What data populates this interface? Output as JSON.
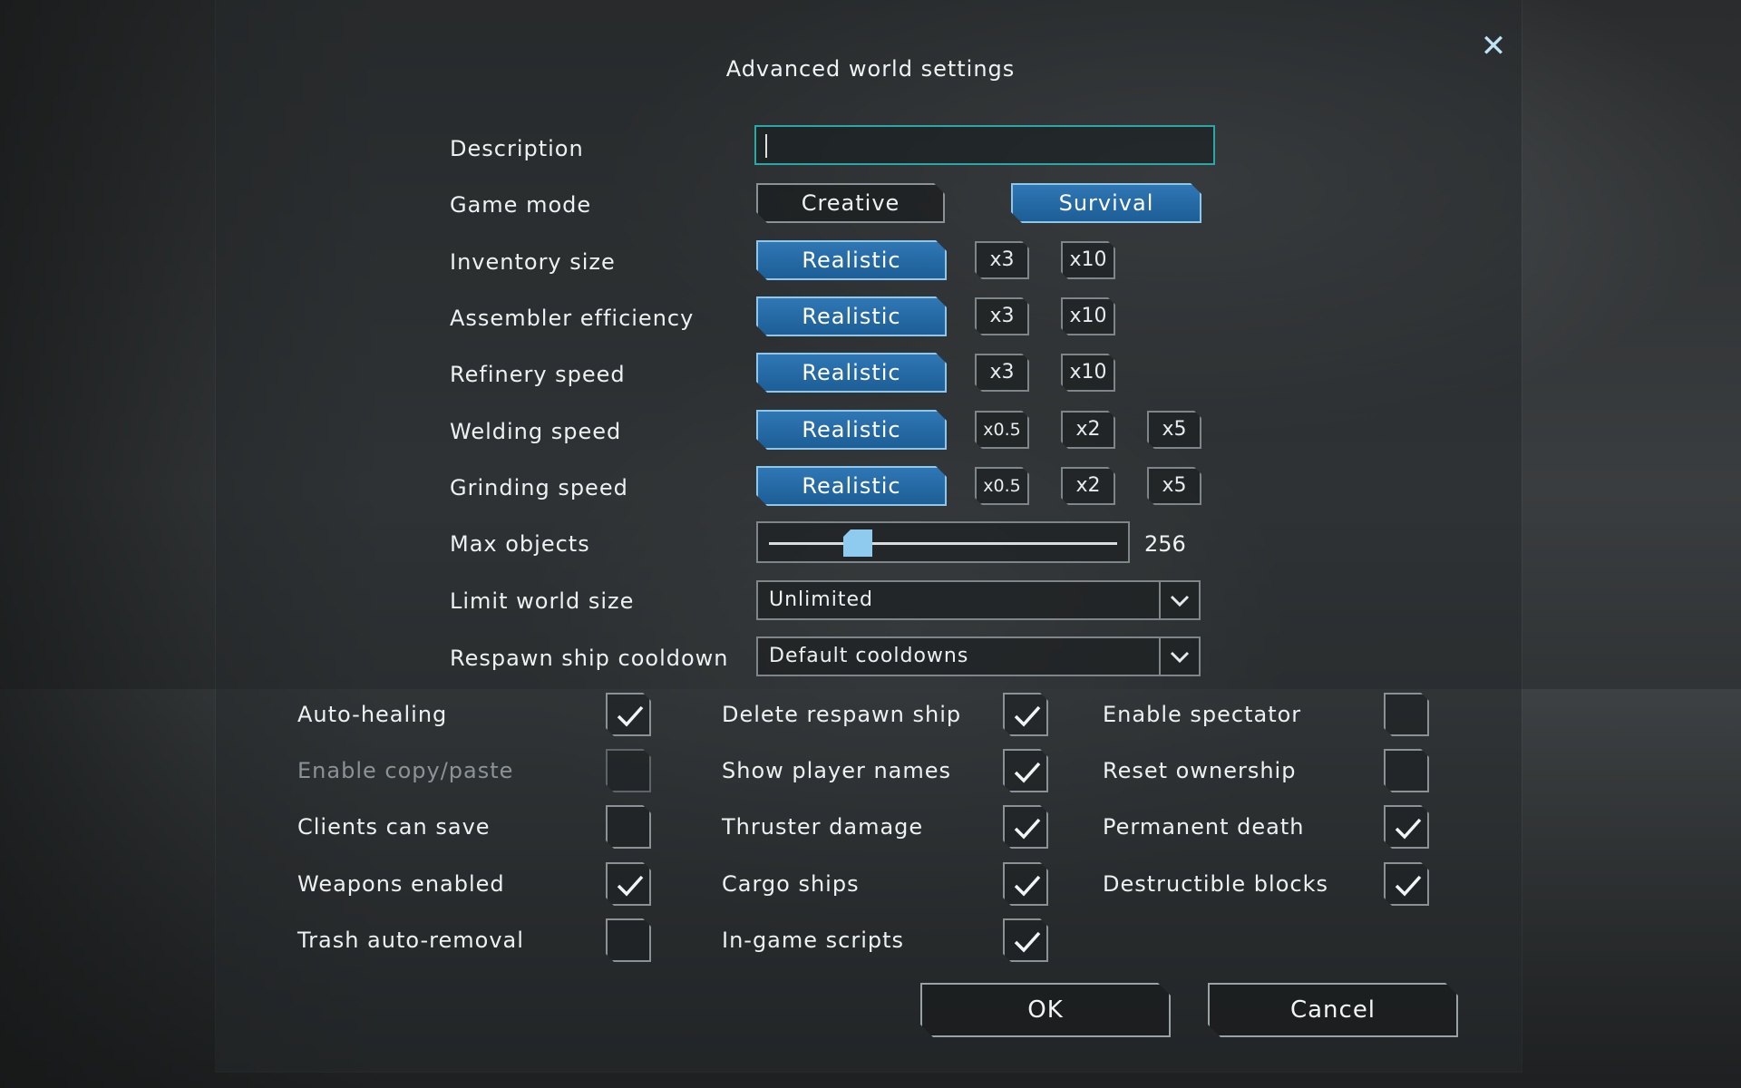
{
  "dialog": {
    "title": "Advanced world settings",
    "close_icon": "close-icon"
  },
  "description": {
    "label": "Description",
    "value": ""
  },
  "game_mode": {
    "label": "Game mode",
    "options": [
      "Creative",
      "Survival"
    ],
    "selected": "Survival"
  },
  "inventory_size": {
    "label": "Inventory size",
    "options": [
      "Realistic",
      "x3",
      "x10"
    ],
    "selected": "Realistic"
  },
  "assembler_efficiency": {
    "label": "Assembler efficiency",
    "options": [
      "Realistic",
      "x3",
      "x10"
    ],
    "selected": "Realistic"
  },
  "refinery_speed": {
    "label": "Refinery speed",
    "options": [
      "Realistic",
      "x3",
      "x10"
    ],
    "selected": "Realistic"
  },
  "welding_speed": {
    "label": "Welding speed",
    "options": [
      "Realistic",
      "x0.5",
      "x2",
      "x5"
    ],
    "selected": "Realistic"
  },
  "grinding_speed": {
    "label": "Grinding speed",
    "options": [
      "Realistic",
      "x0.5",
      "x2",
      "x5"
    ],
    "selected": "Realistic"
  },
  "max_objects": {
    "label": "Max objects",
    "value": "256"
  },
  "limit_world_size": {
    "label": "Limit world size",
    "selected": "Unlimited"
  },
  "respawn_ship_cooldown": {
    "label": "Respawn ship cooldown",
    "selected": "Default cooldowns"
  },
  "checkboxes": {
    "col1": [
      {
        "label": "Auto-healing",
        "checked": true,
        "enabled": true
      },
      {
        "label": "Enable copy/paste",
        "checked": false,
        "enabled": false
      },
      {
        "label": "Clients can save",
        "checked": false,
        "enabled": true
      },
      {
        "label": "Weapons enabled",
        "checked": true,
        "enabled": true
      },
      {
        "label": "Trash auto-removal",
        "checked": false,
        "enabled": true
      }
    ],
    "col2": [
      {
        "label": "Delete respawn ship",
        "checked": true,
        "enabled": true
      },
      {
        "label": "Show player names",
        "checked": true,
        "enabled": true
      },
      {
        "label": "Thruster damage",
        "checked": true,
        "enabled": true
      },
      {
        "label": "Cargo ships",
        "checked": true,
        "enabled": true
      },
      {
        "label": "In-game scripts",
        "checked": true,
        "enabled": true
      }
    ],
    "col3": [
      {
        "label": "Enable spectator",
        "checked": false,
        "enabled": true
      },
      {
        "label": "Reset ownership",
        "checked": false,
        "enabled": true
      },
      {
        "label": "Permanent death",
        "checked": true,
        "enabled": true
      },
      {
        "label": "Destructible blocks",
        "checked": true,
        "enabled": true
      }
    ]
  },
  "actions": {
    "ok": "OK",
    "cancel": "Cancel"
  },
  "colors": {
    "accent": "#2f77b5",
    "focus": "#2aa7a7",
    "close": "#bfe4f6",
    "slider_thumb": "#8fcbee"
  }
}
